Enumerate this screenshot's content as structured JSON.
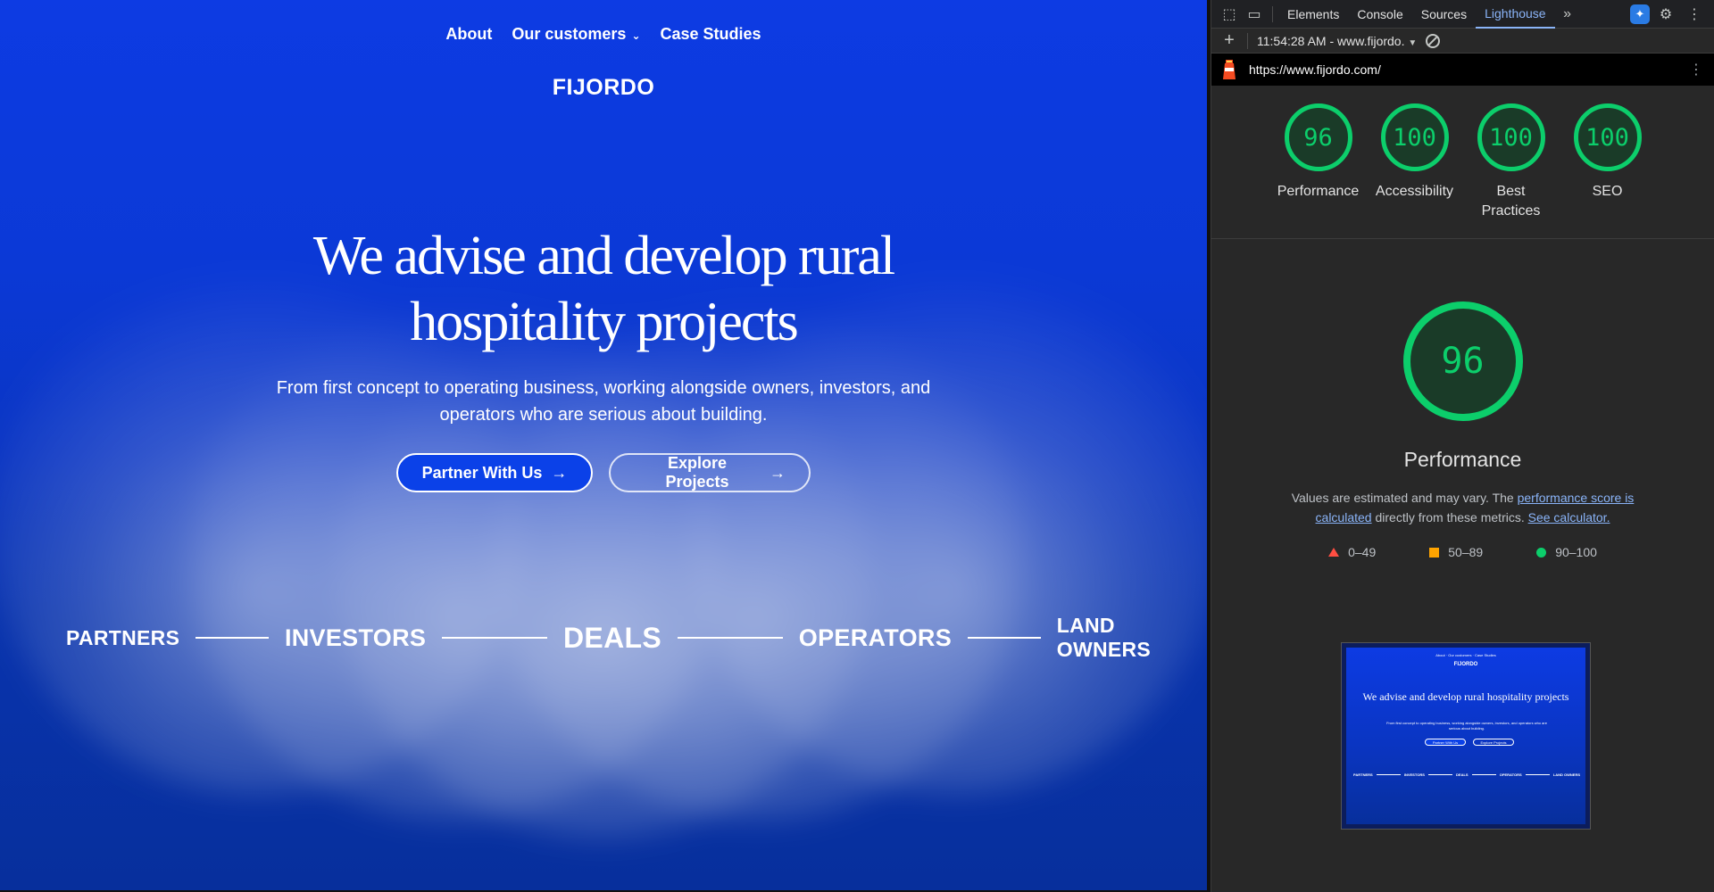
{
  "site": {
    "nav": {
      "about": "About",
      "customers": "Our customers",
      "case_studies": "Case Studies"
    },
    "brand": "FIJORDO",
    "headline_1": "We advise and develop rural",
    "headline_2": "hospitality projects",
    "subtitle": "From first concept to operating business, working alongside owners, investors, and operators who are serious about building.",
    "cta_primary": "Partner With Us",
    "cta_secondary": "Explore Projects",
    "ribbon": [
      "PARTNERS",
      "INVESTORS",
      "DEALS",
      "OPERATORS",
      "LAND OWNERS"
    ]
  },
  "devtools": {
    "tabs": [
      "Elements",
      "Console",
      "Sources",
      "Lighthouse"
    ],
    "active_tab": "Lighthouse",
    "report_selector": "11:54:28 AM - www.fijordo.",
    "url": "https://www.fijordo.com/",
    "scores": [
      {
        "value": "96",
        "label": "Performance"
      },
      {
        "value": "100",
        "label": "Accessibility"
      },
      {
        "value": "100",
        "label": "Best Practices"
      },
      {
        "value": "100",
        "label": "SEO"
      }
    ],
    "performance": {
      "value": "96",
      "title": "Performance",
      "note_prefix": "Values are estimated and may vary. The",
      "note_link1": "performance score is calculated",
      "note_middle": "directly from these metrics.",
      "note_link2": "See calculator."
    },
    "legend": {
      "fail": "0–49",
      "average": "50–89",
      "pass": "90–100"
    },
    "colors": {
      "pass": "#0cce6b",
      "average": "#ffa400",
      "fail": "#ff4e42",
      "link": "#8ab4f8"
    }
  },
  "thumbnail": {
    "nav": "About · Our customers · Case Studies",
    "brand": "FIJORDO",
    "headline": "We advise and develop rural hospitality projects",
    "subtitle": "From first concept to operating business, working alongside owners, investors, and operators who are serious about building.",
    "cta_primary": "Partner With Us",
    "cta_secondary": "Explore Projects",
    "ribbon": [
      "PARTNERS",
      "INVESTORS",
      "DEALS",
      "OPERATORS",
      "LAND OWNERS"
    ]
  }
}
